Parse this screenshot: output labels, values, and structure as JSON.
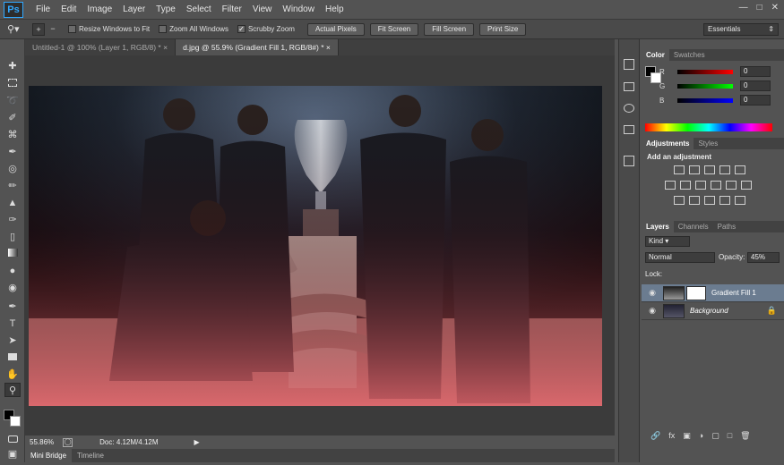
{
  "app": {
    "logo": "Ps"
  },
  "menu": [
    "File",
    "Edit",
    "Image",
    "Layer",
    "Type",
    "Select",
    "Filter",
    "View",
    "Window",
    "Help"
  ],
  "window_controls": [
    "—",
    "□",
    "✕"
  ],
  "options_bar": {
    "resize_windows_label": "Resize Windows to Fit",
    "zoom_all_label": "Zoom All Windows",
    "scrubby_zoom_label": "Scrubby Zoom",
    "actual_pixels_label": "Actual Pixels",
    "fit_screen_label": "Fit Screen",
    "fill_screen_label": "Fill Screen",
    "print_size_label": "Print Size",
    "workspace": "Essentials"
  },
  "tabs": [
    {
      "label": "Untitled-1 @ 100% (Layer 1, RGB/8) *  ×"
    },
    {
      "label": "d.jpg @ 55.9% (Gradient Fill 1, RGB/8#) *  ×"
    }
  ],
  "status": {
    "zoom": "55.86%",
    "doc": "Doc: 4.12M/4.12M"
  },
  "bottom_tabs": [
    "Mini Bridge",
    "Timeline"
  ],
  "color_panel": {
    "tabs": [
      "Color",
      "Swatches"
    ],
    "r_label": "R",
    "g_label": "G",
    "b_label": "B",
    "r_value": "0",
    "g_value": "0",
    "b_value": "0"
  },
  "adjustments_panel": {
    "tabs": [
      "Adjustments",
      "Styles"
    ],
    "heading": "Add an adjustment"
  },
  "layers_panel": {
    "tabs": [
      "Layers",
      "Channels",
      "Paths"
    ],
    "filter_kind": "Kind",
    "blend_mode": "Normal",
    "opacity_label": "Opacity:",
    "opacity_value": "45%",
    "lock_label": "Lock:",
    "layers": [
      {
        "name": "Gradient Fill 1"
      },
      {
        "name": "Background"
      }
    ]
  },
  "colors": {
    "accent": "#31a8ff",
    "selected_layer": "#6b7c90"
  }
}
